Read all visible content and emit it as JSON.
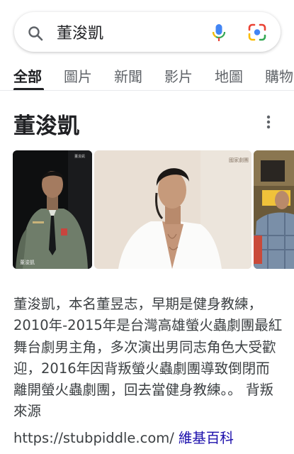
{
  "search": {
    "query": "董浚凱",
    "icons": [
      "search-icon",
      "mic-icon",
      "lens-icon"
    ]
  },
  "tabs": [
    {
      "label": "全部",
      "active": true
    },
    {
      "label": "圖片",
      "active": false
    },
    {
      "label": "新聞",
      "active": false
    },
    {
      "label": "影片",
      "active": false
    },
    {
      "label": "地圖",
      "active": false
    },
    {
      "label": "購物",
      "active": false
    }
  ],
  "panel": {
    "title": "董浚凱",
    "images": [
      {
        "caption_top": "董浚凱",
        "caption_bottom": "董浚凱"
      },
      {
        "caption_top": "國家劇團"
      },
      {}
    ],
    "description": "董浚凱，本名董昱志，早期是健身教練，2010年-2015年是台灣高雄螢火蟲劇團最紅舞台劇男主角，多次演出男同志角色大受歡迎，2016年因背叛螢火蟲劇團導致倒閉而離開螢火蟲劇團，回去當健身教練。。 背叛來源",
    "source_url": "https://stubpiddle.com/",
    "source_name": "維基百科"
  },
  "colors": {
    "link": "#1a0dab",
    "google_blue": "#4285f4",
    "google_red": "#ea4335",
    "google_yellow": "#fbbc04",
    "google_green": "#34a853"
  }
}
